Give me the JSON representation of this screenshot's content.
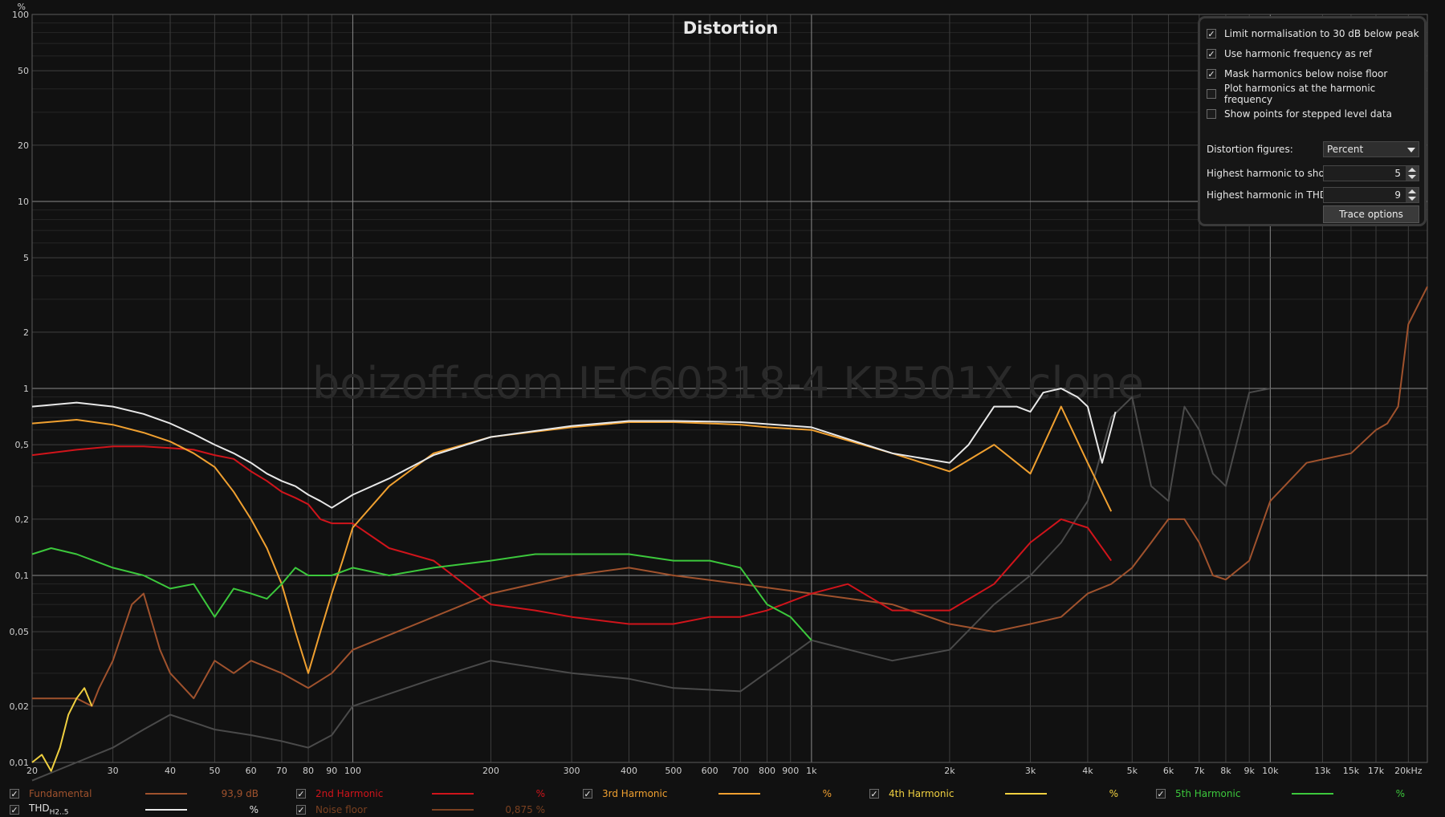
{
  "title": "Distortion",
  "watermark": "boizoff.com IEC60318-4 KB501X clone",
  "y_unit": "%",
  "options": {
    "checkboxes": [
      {
        "label": "Limit normalisation to 30 dB below peak",
        "checked": true
      },
      {
        "label": "Use harmonic frequency as ref",
        "checked": true
      },
      {
        "label": "Mask harmonics below noise floor",
        "checked": true
      },
      {
        "label": "Plot harmonics at the harmonic frequency",
        "checked": false
      },
      {
        "label": "Show points for stepped level data",
        "checked": false
      }
    ],
    "distortion_figures_label": "Distortion figures:",
    "distortion_figures_value": "Percent",
    "highest_show_label": "Highest harmonic to show:",
    "highest_show_value": "5",
    "highest_thd_label": "Highest harmonic in THD:",
    "highest_thd_value": "9",
    "trace_options_label": "Trace options"
  },
  "legend": [
    {
      "name": "Fundamental",
      "value": "93,9 dB",
      "color": "#a0522d",
      "checked": true
    },
    {
      "name": "2nd Harmonic",
      "value": "%",
      "color": "#d0141b",
      "checked": true
    },
    {
      "name": "3rd Harmonic",
      "value": "%",
      "color": "#f0a030",
      "checked": true
    },
    {
      "name": "4th Harmonic",
      "value": "%",
      "color": "#f0d040",
      "checked": true
    },
    {
      "name": "5th Harmonic",
      "value": "%",
      "color": "#3cc83c",
      "checked": true
    },
    {
      "name": "THD",
      "sub": "H2..5",
      "value": "%",
      "color": "#e8e8e8",
      "checked": true
    },
    {
      "name": "Noise floor",
      "value": "0,875 %",
      "color": "#7a4020",
      "checked": true
    }
  ],
  "chart_data": {
    "type": "line",
    "title": "Distortion",
    "x_scale": "log",
    "y_scale": "log",
    "xlim": [
      20,
      22000
    ],
    "ylim": [
      0.01,
      100
    ],
    "ylabel": "%",
    "grid": true,
    "x_ticks": [
      {
        "v": 20,
        "l": "20"
      },
      {
        "v": 30,
        "l": "30"
      },
      {
        "v": 40,
        "l": "40"
      },
      {
        "v": 50,
        "l": "50"
      },
      {
        "v": 60,
        "l": "60"
      },
      {
        "v": 70,
        "l": "70"
      },
      {
        "v": 80,
        "l": "80"
      },
      {
        "v": 90,
        "l": "90"
      },
      {
        "v": 100,
        "l": "100"
      },
      {
        "v": 200,
        "l": "200"
      },
      {
        "v": 300,
        "l": "300"
      },
      {
        "v": 400,
        "l": "400"
      },
      {
        "v": 500,
        "l": "500"
      },
      {
        "v": 600,
        "l": "600"
      },
      {
        "v": 700,
        "l": "700"
      },
      {
        "v": 800,
        "l": "800"
      },
      {
        "v": 900,
        "l": "900"
      },
      {
        "v": 1000,
        "l": "1k"
      },
      {
        "v": 2000,
        "l": "2k"
      },
      {
        "v": 3000,
        "l": "3k"
      },
      {
        "v": 4000,
        "l": "4k"
      },
      {
        "v": 5000,
        "l": "5k"
      },
      {
        "v": 6000,
        "l": "6k"
      },
      {
        "v": 7000,
        "l": "7k"
      },
      {
        "v": 8000,
        "l": "8k"
      },
      {
        "v": 9000,
        "l": "9k"
      },
      {
        "v": 10000,
        "l": "10k"
      },
      {
        "v": 13000,
        "l": "13k"
      },
      {
        "v": 15000,
        "l": "15k"
      },
      {
        "v": 17000,
        "l": "17k"
      },
      {
        "v": 20000,
        "l": "20kHz"
      }
    ],
    "y_ticks": [
      {
        "v": 0.01,
        "l": "0,01"
      },
      {
        "v": 0.02,
        "l": "0,02"
      },
      {
        "v": 0.05,
        "l": "0,05"
      },
      {
        "v": 0.1,
        "l": "0,1"
      },
      {
        "v": 0.2,
        "l": "0,2"
      },
      {
        "v": 0.5,
        "l": "0,5"
      },
      {
        "v": 1,
        "l": "1"
      },
      {
        "v": 2,
        "l": "2"
      },
      {
        "v": 5,
        "l": "5"
      },
      {
        "v": 10,
        "l": "10"
      },
      {
        "v": 20,
        "l": "20"
      },
      {
        "v": 50,
        "l": "50"
      },
      {
        "v": 100,
        "l": "100"
      }
    ],
    "series": [
      {
        "name": "Noise floor",
        "color": "#4a4a4a",
        "x": [
          20,
          25,
          30,
          35,
          40,
          50,
          60,
          70,
          80,
          90,
          100,
          150,
          200,
          300,
          400,
          500,
          700,
          1000,
          1500,
          2000,
          2500,
          3000,
          3500,
          4000,
          4500,
          5000,
          5500,
          6000,
          6500,
          7000,
          7500,
          8000,
          9000,
          10000
        ],
        "y": [
          0.008,
          0.01,
          0.012,
          0.015,
          0.018,
          0.015,
          0.014,
          0.013,
          0.012,
          0.014,
          0.02,
          0.028,
          0.035,
          0.03,
          0.028,
          0.025,
          0.024,
          0.045,
          0.035,
          0.04,
          0.07,
          0.1,
          0.15,
          0.25,
          0.7,
          0.9,
          0.3,
          0.25,
          0.8,
          0.6,
          0.35,
          0.3,
          0.95,
          1.0
        ]
      },
      {
        "name": "Fundamental",
        "color": "#a0522d",
        "x": [
          20,
          25,
          27,
          28,
          30,
          33,
          35,
          38,
          40,
          45,
          50,
          55,
          60,
          70,
          80,
          90,
          100,
          150,
          200,
          300,
          400,
          500,
          700,
          1000,
          1500,
          2000,
          2500,
          3000,
          3500,
          4000,
          4500,
          5000,
          5500,
          6000,
          6500,
          7000,
          7500,
          8000,
          9000,
          10000,
          12000,
          15000,
          17000,
          18000,
          19000,
          20000,
          22000
        ],
        "y": [
          0.022,
          0.022,
          0.02,
          0.025,
          0.035,
          0.07,
          0.08,
          0.04,
          0.03,
          0.022,
          0.035,
          0.03,
          0.035,
          0.03,
          0.025,
          0.03,
          0.04,
          0.06,
          0.08,
          0.1,
          0.11,
          0.1,
          0.09,
          0.08,
          0.07,
          0.055,
          0.05,
          0.055,
          0.06,
          0.08,
          0.09,
          0.11,
          0.15,
          0.2,
          0.2,
          0.15,
          0.1,
          0.095,
          0.12,
          0.25,
          0.4,
          0.45,
          0.6,
          0.65,
          0.8,
          2.2,
          3.5
        ]
      },
      {
        "name": "2nd Harmonic",
        "color": "#d0141b",
        "x": [
          20,
          25,
          30,
          35,
          40,
          45,
          50,
          55,
          60,
          65,
          70,
          75,
          80,
          85,
          90,
          100,
          120,
          150,
          200,
          250,
          300,
          400,
          500,
          600,
          700,
          800,
          1000,
          1200,
          1500,
          2000,
          2500,
          3000,
          3500,
          4000,
          4500
        ],
        "y": [
          0.44,
          0.47,
          0.49,
          0.49,
          0.48,
          0.47,
          0.44,
          0.42,
          0.36,
          0.32,
          0.28,
          0.26,
          0.24,
          0.2,
          0.19,
          0.19,
          0.14,
          0.12,
          0.07,
          0.065,
          0.06,
          0.055,
          0.055,
          0.06,
          0.06,
          0.065,
          0.08,
          0.09,
          0.065,
          0.065,
          0.09,
          0.15,
          0.2,
          0.18,
          0.12
        ]
      },
      {
        "name": "3rd Harmonic",
        "color": "#f0a030",
        "x": [
          20,
          25,
          30,
          35,
          40,
          45,
          50,
          55,
          60,
          65,
          70,
          75,
          80,
          85,
          90,
          95,
          100,
          120,
          150,
          200,
          300,
          400,
          500,
          600,
          700,
          800,
          1000,
          1500,
          2000,
          2500,
          3000,
          3500,
          4000,
          4500
        ],
        "y": [
          0.65,
          0.68,
          0.64,
          0.58,
          0.52,
          0.45,
          0.38,
          0.28,
          0.2,
          0.14,
          0.09,
          0.05,
          0.03,
          0.05,
          0.08,
          0.12,
          0.18,
          0.3,
          0.45,
          0.55,
          0.62,
          0.66,
          0.66,
          0.65,
          0.64,
          0.62,
          0.6,
          0.45,
          0.36,
          0.5,
          0.35,
          0.8,
          0.4,
          0.22
        ]
      },
      {
        "name": "4th Harmonic",
        "color": "#f0d040",
        "x": [
          20,
          21,
          22,
          23,
          24,
          25,
          26,
          27
        ],
        "y": [
          0.01,
          0.011,
          0.009,
          0.012,
          0.018,
          0.022,
          0.025,
          0.02
        ]
      },
      {
        "name": "5th Harmonic",
        "color": "#3cc83c",
        "x": [
          20,
          22,
          25,
          30,
          35,
          40,
          45,
          50,
          55,
          60,
          65,
          70,
          75,
          80,
          90,
          100,
          120,
          150,
          200,
          250,
          300,
          400,
          500,
          600,
          700,
          800,
          900,
          1000
        ],
        "y": [
          0.13,
          0.14,
          0.13,
          0.11,
          0.1,
          0.085,
          0.09,
          0.06,
          0.085,
          0.08,
          0.075,
          0.09,
          0.11,
          0.1,
          0.1,
          0.11,
          0.1,
          0.11,
          0.12,
          0.13,
          0.13,
          0.13,
          0.12,
          0.12,
          0.11,
          0.07,
          0.06,
          0.045
        ]
      },
      {
        "name": "THD",
        "color": "#e8e8e8",
        "x": [
          20,
          25,
          30,
          35,
          40,
          45,
          50,
          55,
          60,
          65,
          70,
          75,
          80,
          85,
          90,
          100,
          120,
          150,
          200,
          300,
          400,
          500,
          700,
          1000,
          1500,
          2000,
          2200,
          2500,
          2800,
          3000,
          3200,
          3500,
          3800,
          4000,
          4300,
          4600
        ],
        "y": [
          0.8,
          0.84,
          0.8,
          0.73,
          0.65,
          0.57,
          0.5,
          0.45,
          0.4,
          0.35,
          0.32,
          0.3,
          0.27,
          0.25,
          0.23,
          0.27,
          0.33,
          0.44,
          0.55,
          0.63,
          0.67,
          0.67,
          0.66,
          0.62,
          0.45,
          0.4,
          0.5,
          0.8,
          0.8,
          0.75,
          0.95,
          1.0,
          0.9,
          0.8,
          0.4,
          0.75
        ]
      }
    ]
  }
}
